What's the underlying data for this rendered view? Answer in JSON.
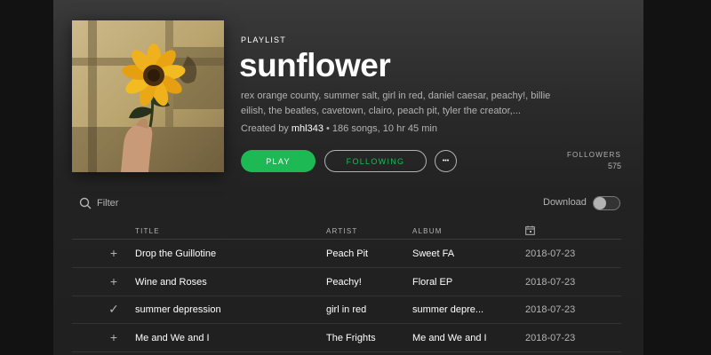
{
  "playlist": {
    "type_label": "PLAYLIST",
    "title": "sunflower",
    "artists_line": "rex orange county, summer salt, girl in red, daniel caesar, peachy!, billie eilish, the beatles, cavetown, clairo, peach pit, tyler the creator,...",
    "created_by_prefix": "Created by ",
    "owner": "mhl343",
    "stats": " • 186 songs, 10 hr 45 min",
    "play_label": "PLAY",
    "following_label": "FOLLOWING",
    "more_label": "•••",
    "followers_label": "FOLLOWERS",
    "followers_count": "575"
  },
  "toolbar": {
    "filter_placeholder": "Filter",
    "download_label": "Download",
    "download_enabled": false
  },
  "table": {
    "headers": {
      "title": "TITLE",
      "artist": "ARTIST",
      "album": "ALBUM",
      "date": "calendar-icon"
    },
    "rows": [
      {
        "icon": "plus-icon",
        "title": "Drop the Guillotine",
        "artist": "Peach Pit",
        "album": "Sweet FA",
        "date": "2018-07-23"
      },
      {
        "icon": "plus-icon",
        "title": "Wine and Roses",
        "artist": "Peachy!",
        "album": "Floral EP",
        "date": "2018-07-23"
      },
      {
        "icon": "check-icon",
        "title": "summer depression",
        "artist": "girl in red",
        "album": "summer depre...",
        "date": "2018-07-23"
      },
      {
        "icon": "plus-icon",
        "title": "Me and We and I",
        "artist": "The Frights",
        "album": "Me and We and I",
        "date": "2018-07-23"
      }
    ]
  },
  "colors": {
    "accent": "#1db954",
    "text_secondary": "#b3b3b3"
  }
}
